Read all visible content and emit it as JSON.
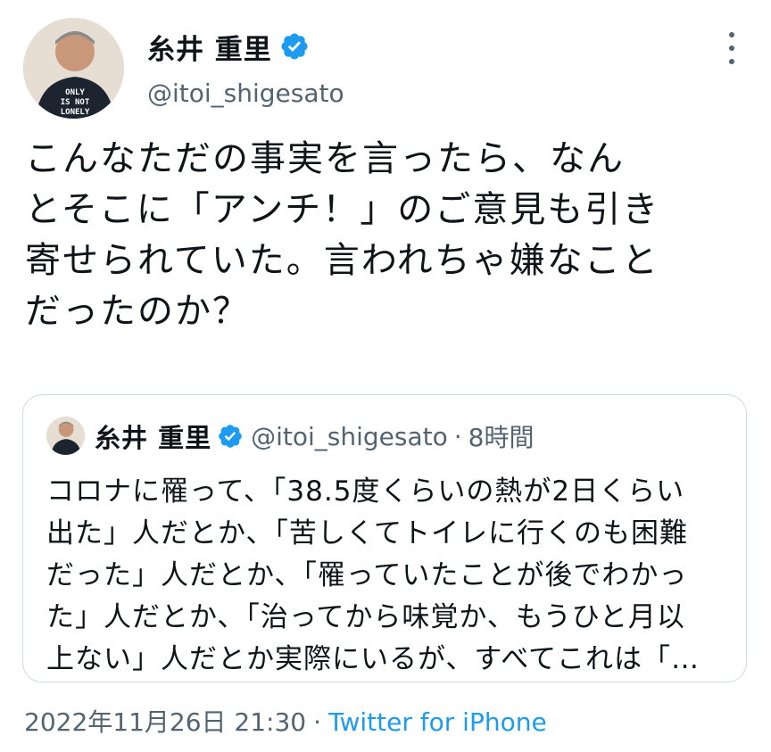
{
  "author": {
    "display_name": "糸井 重里",
    "handle": "@itoi_shigesato",
    "verified": true,
    "avatar_shirt_text": "ONLY IS NOT LONELY"
  },
  "tweet": {
    "lines": [
      "こんなただの事実を言ったら、なん",
      "とそこに「アンチ！」のご意見も引き",
      "寄せられていた。言われちゃ嫌なこと",
      "だったのか？"
    ]
  },
  "quoted": {
    "display_name": "糸井 重里",
    "handle": "@itoi_shigesato",
    "separator": "·",
    "time": "8時間",
    "lines": [
      "コロナに罹って、「38.5度くらいの熱が2日くらい",
      "出た」人だとか、「苦しくてトイレに行くのも困難",
      "だった」人だとか、「罹っていたことが後でわかっ",
      "た」人だとか、「治ってから味覚か、もうひと月以",
      "上ない」人だとか実際にいるが、すべてこれは「…"
    ]
  },
  "meta": {
    "timestamp": "2022年11月26日 21:30",
    "separator": "·",
    "source": "Twitter for iPhone"
  },
  "colors": {
    "verified_badge": "#1d9bf0",
    "link": "#1d9bf0",
    "secondary_text": "#536471",
    "border": "#cfd9de"
  },
  "icons": [
    "verified-badge-icon",
    "more-options-icon"
  ]
}
